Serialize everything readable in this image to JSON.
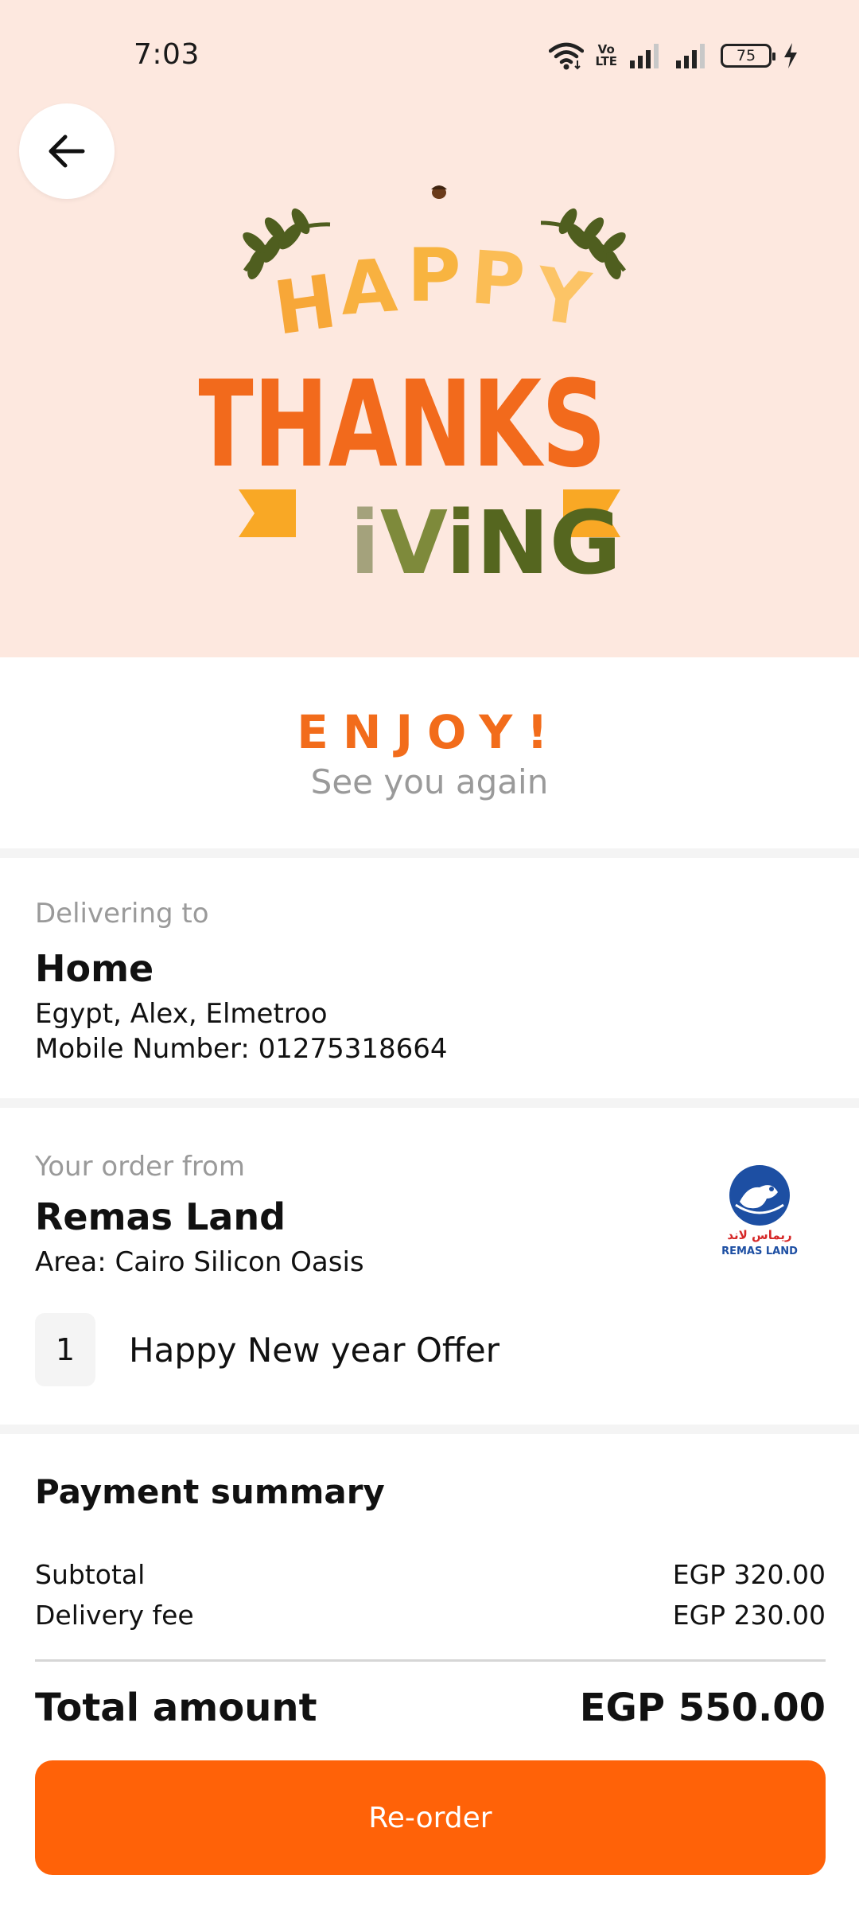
{
  "status_bar": {
    "time": "7:03",
    "network_label": "Vo LTE",
    "battery": "75"
  },
  "hero": {
    "banner_text": [
      "HAPPY",
      "THANKS",
      "iViNG"
    ],
    "background_color": "#fde8df",
    "icons": [
      "back-arrow-icon",
      "wifi-icon",
      "signal-icon",
      "battery-icon",
      "charging-icon"
    ]
  },
  "thanks": {
    "title": "ENJOY!",
    "subtitle": "See you again"
  },
  "delivery": {
    "label": "Delivering to",
    "place": "Home",
    "address": "Egypt, Alex, Elmetroo",
    "mobile": "Mobile Number: 01275318664"
  },
  "order": {
    "label": "Your order from",
    "store": "Remas Land",
    "area": "Area: Cairo Silicon Oasis",
    "logo_text_ar": "ريماس لاند",
    "logo_text_en": "REMAS LAND",
    "items": [
      {
        "qty": "1",
        "name": "Happy New year Offer"
      }
    ]
  },
  "payment": {
    "title": "Payment summary",
    "subtotal_label": "Subtotal",
    "subtotal_value": "EGP 320.00",
    "delivery_label": "Delivery fee",
    "delivery_value": "EGP 230.00",
    "total_label": "Total amount",
    "total_value": "EGP 550.00"
  },
  "actions": {
    "reorder_label": "Re-order"
  },
  "colors": {
    "accent": "#ff6208",
    "enjoy_text": "#f26c1b",
    "muted_text": "#9a9a9a",
    "divider": "#f4f4f4"
  }
}
